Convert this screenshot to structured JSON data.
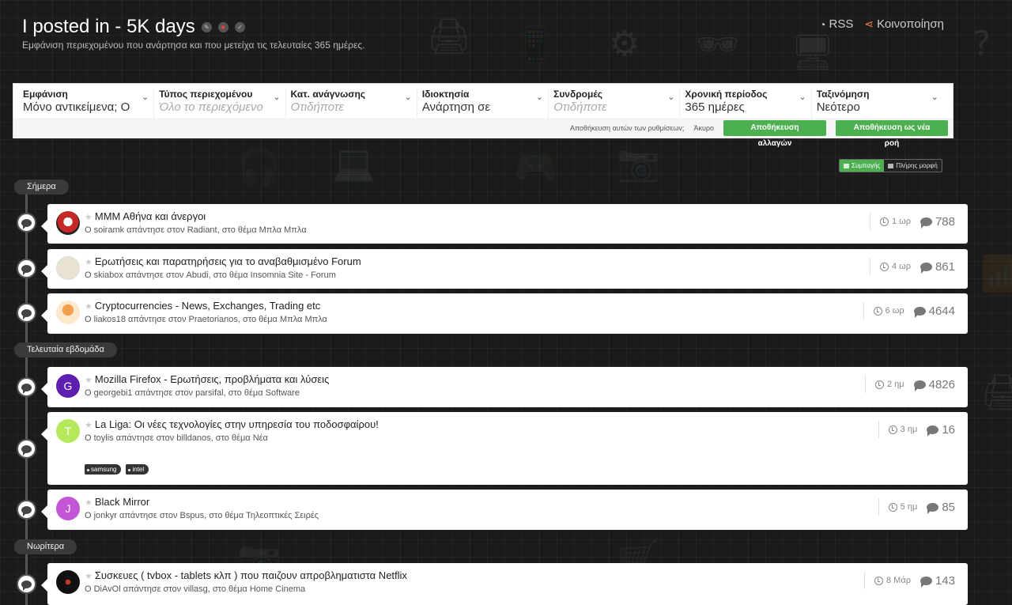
{
  "header": {
    "title": "I posted in - 5K days",
    "subtitle": "Εμφάνιση περιεχομένου που ανάρτησα και που μετείχα τις τελευταίες 365 ημέρες.",
    "rss_label": "RSS",
    "share_label": "Κοινοποίηση"
  },
  "filters": [
    {
      "label": "Εμφάνιση",
      "value": "Μόνο αντικείμενα; Ο"
    },
    {
      "label": "Τύπος περιεχομένου",
      "value": "Όλο το περιεχόμενο"
    },
    {
      "label": "Κατ. ανάγνωσης",
      "value": "Οτιδήποτε"
    },
    {
      "label": "Ιδιοκτησία",
      "value": "Ανάρτηση σε"
    },
    {
      "label": "Συνδρομές",
      "value": "Οτιδήποτε"
    },
    {
      "label": "Χρονική περίοδος",
      "value": "365 ημέρες"
    },
    {
      "label": "Ταξινόμηση",
      "value": "Νεότερο"
    }
  ],
  "filter_actions": {
    "save_prompt": "Αποθήκευση αυτών των ρυθμίσεων;",
    "cancel": "Άκυρο",
    "save_changes": "Αποθήκευση αλλαγών",
    "save_new": "Αποθήκευση ως νέα ροή"
  },
  "view_switch": {
    "condensed": "Συμπαγής",
    "expanded": "Πλήρης μορφή"
  },
  "sections": {
    "today": "Σήμερα",
    "last_week": "Τελευταία εβδομάδα",
    "earlier": "Νωρίτερα"
  },
  "items": [
    {
      "title": "ΜΜΜ Αθήνα και άνεργοι",
      "meta": "Ο soiramk απάντησε στον Radiant, στο θέμα Μπλα Μπλα",
      "time": "1 ωρ",
      "replies": "788",
      "avatar_letter": "",
      "avatar_color": "#c62828"
    },
    {
      "title": "Ερωτήσεις και παρατηρήσεις για το αναβαθμισμένο Forum",
      "meta": "Ο skiabox απάντησε στον Abudi, στο θέμα Insomnia Site - Forum",
      "time": "4 ωρ",
      "replies": "861",
      "avatar_letter": "",
      "avatar_color": "#e8e2d2"
    },
    {
      "title": "Cryptocurrencies - News, Exchanges, Trading etc",
      "meta": "Ο liakos18 απάντησε στον Praetorianos, στο θέμα Μπλα Μπλα",
      "time": "6 ωρ",
      "replies": "4644",
      "avatar_letter": "",
      "avatar_color": "#f6d9b0"
    },
    {
      "title": "Mozilla Firefox - Ερωτήσεις, προβλήματα και λύσεις",
      "meta": "Ο georgebi1 απάντησε στον parsifal, στο θέμα Software",
      "time": "2 ημ",
      "replies": "4826",
      "avatar_letter": "G",
      "avatar_color": "#5e1fb0"
    },
    {
      "title": "La Liga: Οι νέες τεχνολογίες στην υπηρεσία του ποδοσφαίρου!",
      "meta": "Ο toylis απάντησε στον billdanos, στο θέμα Νέα",
      "time": "3 ημ",
      "replies": "16",
      "avatar_letter": "T",
      "avatar_color": "#b5e85a",
      "tags": [
        "samsung",
        "intel"
      ]
    },
    {
      "title": "Black Mirror",
      "meta": "Ο jonkyr απάντησε στον Bspus, στο θέμα Τηλεοπτικές Σειρές",
      "time": "5 ημ",
      "replies": "85",
      "avatar_letter": "J",
      "avatar_color": "#c256d6"
    },
    {
      "title": "Συσκευες ( tvbox - tablets κλπ ) που παιζουν απροβληματιστα Netflix",
      "meta": "Ο DiAvOl απάντησε στον villasg, στο θέμα Home Cinema",
      "time": "8 Μάρ",
      "replies": "143",
      "avatar_letter": "",
      "avatar_color": "#111111"
    }
  ]
}
